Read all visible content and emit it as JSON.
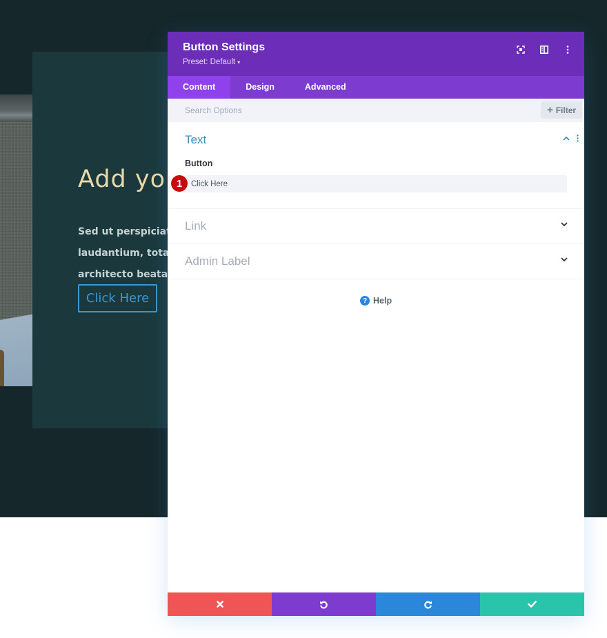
{
  "background": {
    "hero_title": "Add you",
    "hero_text_lines": [
      "Sed ut perspiciatis u",
      "laudantium, totam r",
      "architecto beatae vi"
    ],
    "hero_button": "Click Here",
    "colors": {
      "page": "#15272a",
      "card": "#1b393c",
      "title": "#e7d9a8",
      "button": "#3a97d2"
    }
  },
  "modal": {
    "title": "Button Settings",
    "preset_label": "Preset: Default",
    "preset_caret": "▾",
    "header_icons": [
      "focus-mode-icon",
      "split-view-icon",
      "more-options-icon"
    ],
    "tabs": [
      {
        "label": "Content",
        "active": true
      },
      {
        "label": "Design",
        "active": false
      },
      {
        "label": "Advanced",
        "active": false
      }
    ],
    "search": {
      "placeholder": "Search Options",
      "value": ""
    },
    "filter": {
      "icon": "+",
      "label": "Filter"
    },
    "sections": {
      "text": {
        "title": "Text",
        "expanded": true,
        "field_label": "Button",
        "field_value": "Click Here",
        "badge": "1"
      },
      "link": {
        "title": "Link",
        "expanded": false
      },
      "admin": {
        "title": "Admin Label",
        "expanded": false
      }
    },
    "help": {
      "icon": "?",
      "label": "Help"
    },
    "footer": {
      "cancel": "cancel",
      "undo": "undo",
      "redo": "redo",
      "save": "save"
    },
    "colors": {
      "header": "#6c2eb9",
      "tabs": "#7e3bd0",
      "tab_active": "#8f42ec",
      "section_title": "#3d8fb8",
      "cancel": "#ef5555",
      "undo": "#7d3bcf",
      "redo": "#2b87da",
      "save": "#29c4a9",
      "badge": "#c50b0b"
    }
  }
}
